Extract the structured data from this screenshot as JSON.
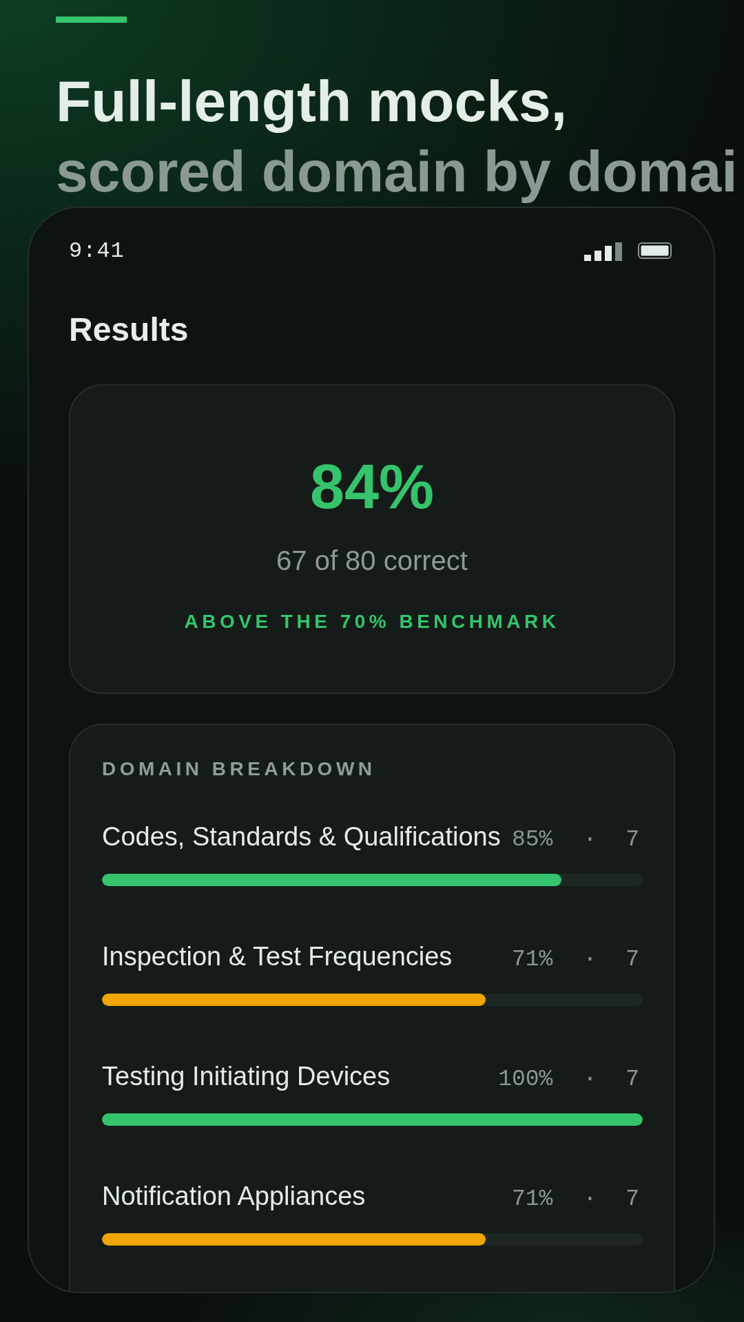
{
  "header": {
    "headline": "Full-length mocks,",
    "subheadline": "scored domain by domai"
  },
  "status_bar": {
    "time": "9:41"
  },
  "screen": {
    "title": "Results"
  },
  "score_card": {
    "percent": "84%",
    "detail": "67 of 80 correct",
    "verdict": "ABOVE THE 70% BENCHMARK"
  },
  "domain_breakdown": {
    "title": "DOMAIN BREAKDOWN",
    "domains": [
      {
        "name": "Codes, Standards & Qualifications",
        "percent": "85%",
        "separator": "·",
        "count": "7",
        "level": 0.85,
        "color": "#35c46c"
      },
      {
        "name": "Inspection & Test Frequencies",
        "percent": "71%",
        "separator": "·",
        "count": "7",
        "level": 0.71,
        "color": "#f0a500"
      },
      {
        "name": "Testing Initiating Devices",
        "percent": "100%",
        "separator": "·",
        "count": "7",
        "level": 1,
        "color": "#35c46c"
      },
      {
        "name": "Notification Appliances",
        "percent": "71%",
        "separator": "·",
        "count": "7",
        "level": 0.71,
        "color": "#f0a500"
      }
    ]
  }
}
